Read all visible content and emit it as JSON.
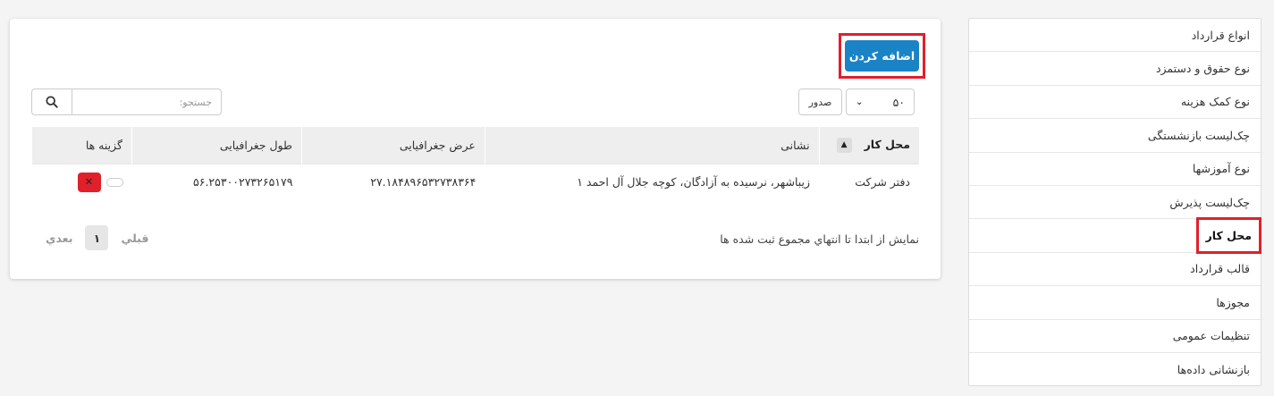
{
  "sidebar": {
    "items": [
      {
        "label": "انواع قرارداد"
      },
      {
        "label": "نوع حقوق و دستمزد"
      },
      {
        "label": "نوع کمک هزینه"
      },
      {
        "label": "چک‌لیست بازنشستگی"
      },
      {
        "label": "نوع آموزشها"
      },
      {
        "label": "چک‌لیست پذیرش"
      },
      {
        "label": "محل کار",
        "active": true
      },
      {
        "label": "قالب قرارداد"
      },
      {
        "label": "مجوزها"
      },
      {
        "label": "تنظیمات عمومی"
      },
      {
        "label": "بازنشانی داده‌ها"
      }
    ]
  },
  "toolbar": {
    "add_label": "اضافه کردن",
    "page_length": "۵۰",
    "export_label": "صدور",
    "search_placeholder": "جستجو:"
  },
  "table": {
    "columns": [
      "محل کار",
      "نشانی",
      "عرض جغرافیایی",
      "طول جغرافیایی",
      "گزینه ها"
    ],
    "rows": [
      {
        "workplace": "دفتر شرکت",
        "address": "زیباشهر، نرسیده به آزادگان، کوچه جلال آل احمد ۱",
        "latitude": "۲۷.۱۸۴۸۹۶۵۳۲۷۳۸۳۶۴",
        "longitude": "۵۶.۲۵۳۰۰۲۷۳۲۶۵۱۷۹"
      }
    ]
  },
  "footer": {
    "info": "نمایش از ابتدا تا انتهاي مجموع ثبت شده ها",
    "prev": "قبلي",
    "page": "۱",
    "next": "بعدي"
  },
  "colors": {
    "primary": "#1a83c6",
    "danger": "#e0202a",
    "highlight": "#e0202a"
  }
}
